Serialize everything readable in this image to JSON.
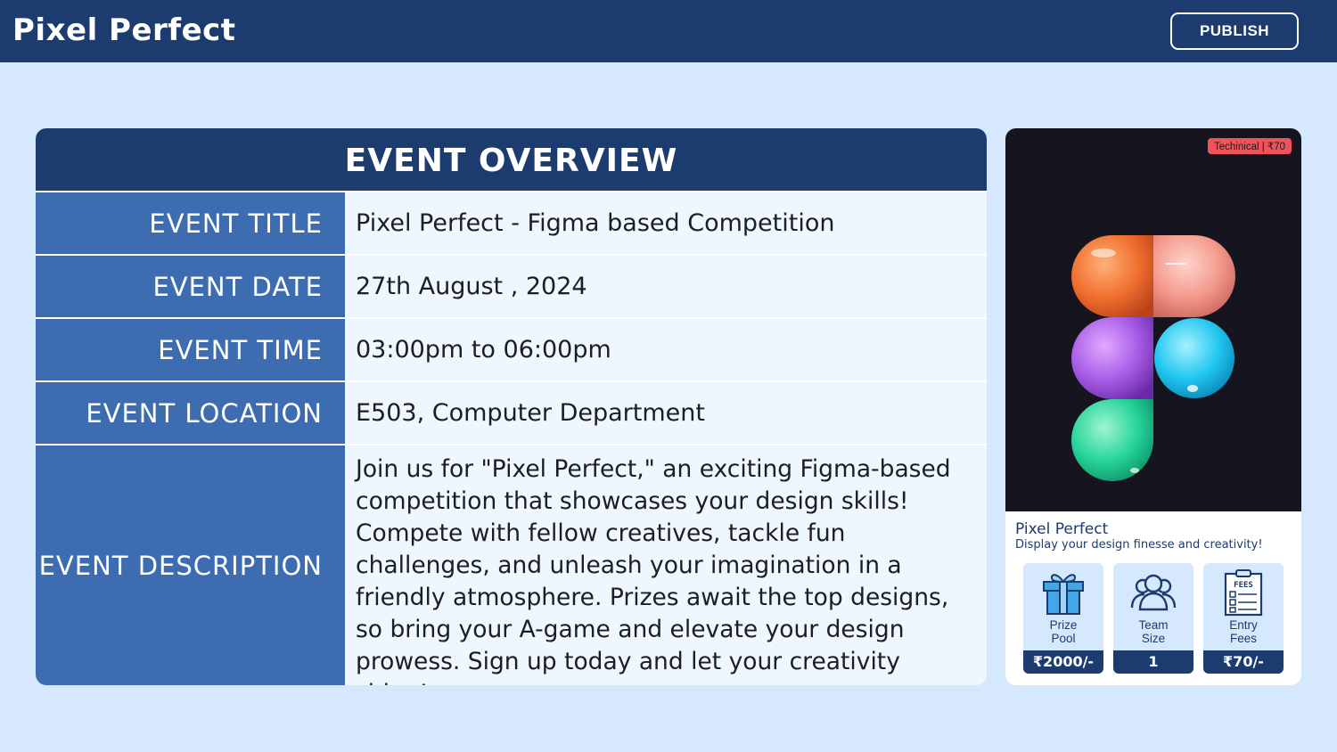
{
  "header": {
    "app_title": "Pixel Perfect",
    "publish_label": "PUBLISH"
  },
  "overview": {
    "heading": "EVENT OVERVIEW",
    "rows": [
      {
        "label": "EVENT TITLE",
        "value": "Pixel Perfect - Figma based Competition"
      },
      {
        "label": "EVENT DATE",
        "value": "27th August , 2024"
      },
      {
        "label": "EVENT TIME",
        "value": "03:00pm to 06:00pm"
      },
      {
        "label": "EVENT LOCATION",
        "value": "E503, Computer Department"
      },
      {
        "label": "EVENT DESCRIPTION",
        "value": "Join us for \"Pixel Perfect,\" an exciting Figma-based competition that showcases your design skills! Compete with fellow creatives, tackle fun challenges, and unleash your imagination in a friendly atmosphere. Prizes await the top designs, so bring your A-game and elevate your design prowess. Sign up today and let your creativity shine!"
      }
    ]
  },
  "card": {
    "image_icon": "figma-logo",
    "tag": "Techinical  |  ₹70",
    "title": "Pixel Perfect",
    "subtitle": "Display your design finesse and creativity!",
    "stats": [
      {
        "icon": "gift-icon",
        "label": "Prize\nPool",
        "value": "₹2000/-"
      },
      {
        "icon": "team-icon",
        "label": "Team\nSize",
        "value": "1"
      },
      {
        "icon": "fees-clipboard-icon",
        "icon_text": "FEES",
        "label": "Entry\nFees",
        "value": "₹70/-"
      }
    ]
  },
  "colors": {
    "background": "#d6e8fd",
    "navy": "#1c3b6e",
    "label_blue": "#3d6db0",
    "value_bg": "#eef6ff",
    "tag_red": "#f0545b"
  }
}
